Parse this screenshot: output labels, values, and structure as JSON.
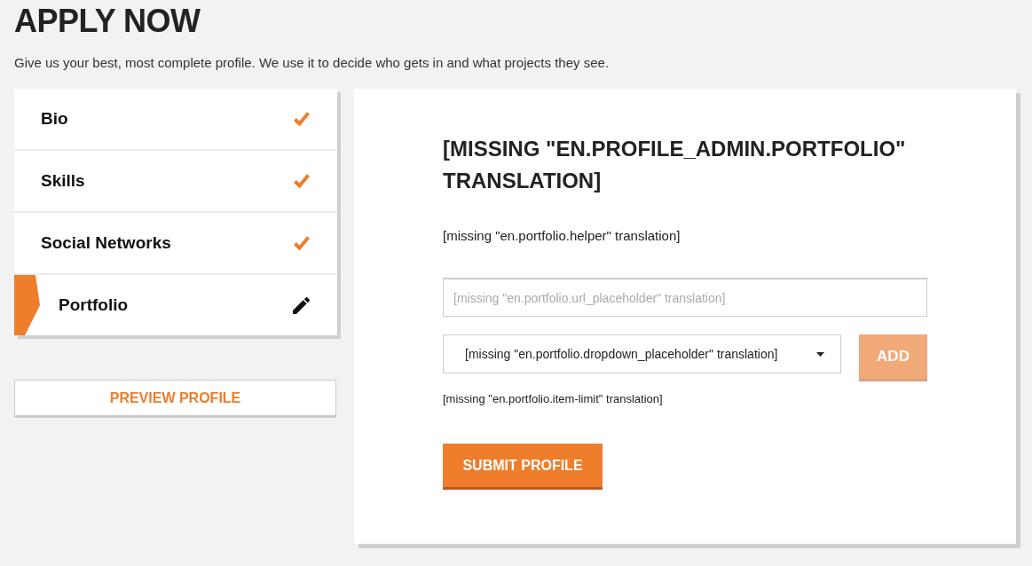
{
  "page": {
    "title": "APPLY NOW",
    "subtitle": "Give us your best, most complete profile. We use it to decide who gets in and what projects they see."
  },
  "sidebar": {
    "items": [
      {
        "label": "Bio",
        "completed": true,
        "selected": false
      },
      {
        "label": "Skills",
        "completed": true,
        "selected": false
      },
      {
        "label": "Social Networks",
        "completed": true,
        "selected": false
      },
      {
        "label": "Portfolio",
        "completed": false,
        "selected": true
      }
    ]
  },
  "preview_button": {
    "label": "PREVIEW PROFILE"
  },
  "form": {
    "heading": "[MISSING \"EN.PROFILE_ADMIN.PORTFOLIO\" TRANSLATION]",
    "helper": "[missing \"en.portfolio.helper\" translation]",
    "url_field": {
      "placeholder": "[missing \"en.portfolio.url_placeholder\" translation]"
    },
    "dropdown": {
      "value": "[missing \"en.portfolio.dropdown_placeholder\" translation]"
    },
    "add_button": {
      "label": "ADD",
      "disabled": true
    },
    "item_limit": "[missing \"en.portfolio.item-limit\" translation]",
    "submit_button": {
      "label": "SUBMIT PROFILE"
    }
  }
}
